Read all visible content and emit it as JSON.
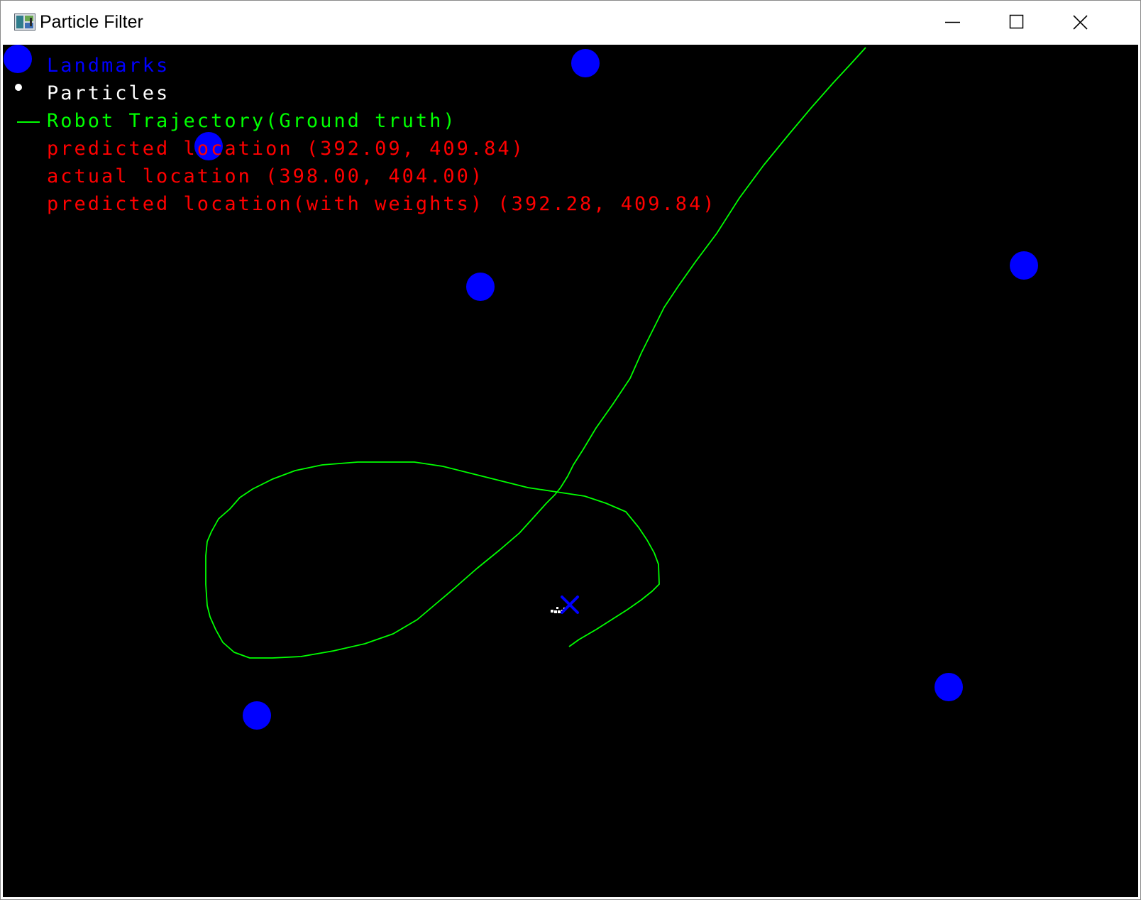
{
  "window": {
    "title": "Particle Filter",
    "controls": {
      "minimize": "minimize-icon",
      "maximize": "maximize-icon",
      "close": "close-icon"
    }
  },
  "legend": {
    "landmarks_label": "Landmarks",
    "particles_label": "Particles",
    "trajectory_label": "Robot Trajectory(Ground truth)",
    "predicted_location": "predicted location  (392.09, 409.84)",
    "actual_location": "actual location (398.00, 404.00)",
    "predicted_location_weights": "predicted location(with weights) (392.28, 409.84)"
  },
  "colors": {
    "background": "#000000",
    "landmark": "#0000ff",
    "particles": "#ffffff",
    "trajectory": "#00ff00",
    "text_red": "#ff0000",
    "marker": "#0000ff"
  },
  "icons": {
    "landmark": "filled-circle-icon",
    "particle": "dot-icon",
    "trajectory": "line-icon",
    "robot_marker": "x-marker-icon"
  }
}
